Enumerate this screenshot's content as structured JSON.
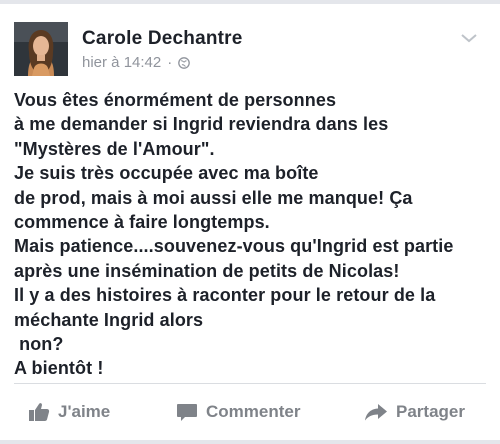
{
  "post": {
    "author": "Carole Dechantre",
    "timestamp": "hier à 14:42",
    "separator": "·",
    "privacy_icon": "globe-icon",
    "menu_icon": "chevron-down-icon",
    "lines": [
      "Vous êtes énormément de personnes",
      "à me demander si Ingrid reviendra dans les",
      "\"Mystères de l'Amour\".",
      "Je suis très occupée avec ma boîte",
      "de prod, mais à moi aussi elle me manque! Ça",
      "commence à faire longtemps.",
      "Mais patience....souvenez-vous qu'Ingrid est partie",
      "après une insémination de petits de Nicolas!",
      "Il y a des histoires à raconter pour le retour de la",
      "méchante Ingrid alors",
      " non?",
      "A bientôt !"
    ]
  },
  "actions": {
    "like_label": "J'aime",
    "comment_label": "Commenter",
    "share_label": "Partager",
    "like_icon": "thumbs-up-icon",
    "comment_icon": "comment-icon",
    "share_icon": "share-arrow-icon"
  },
  "colors": {
    "text": "#1d2129",
    "meta": "#90949c",
    "action": "#7f8389"
  }
}
